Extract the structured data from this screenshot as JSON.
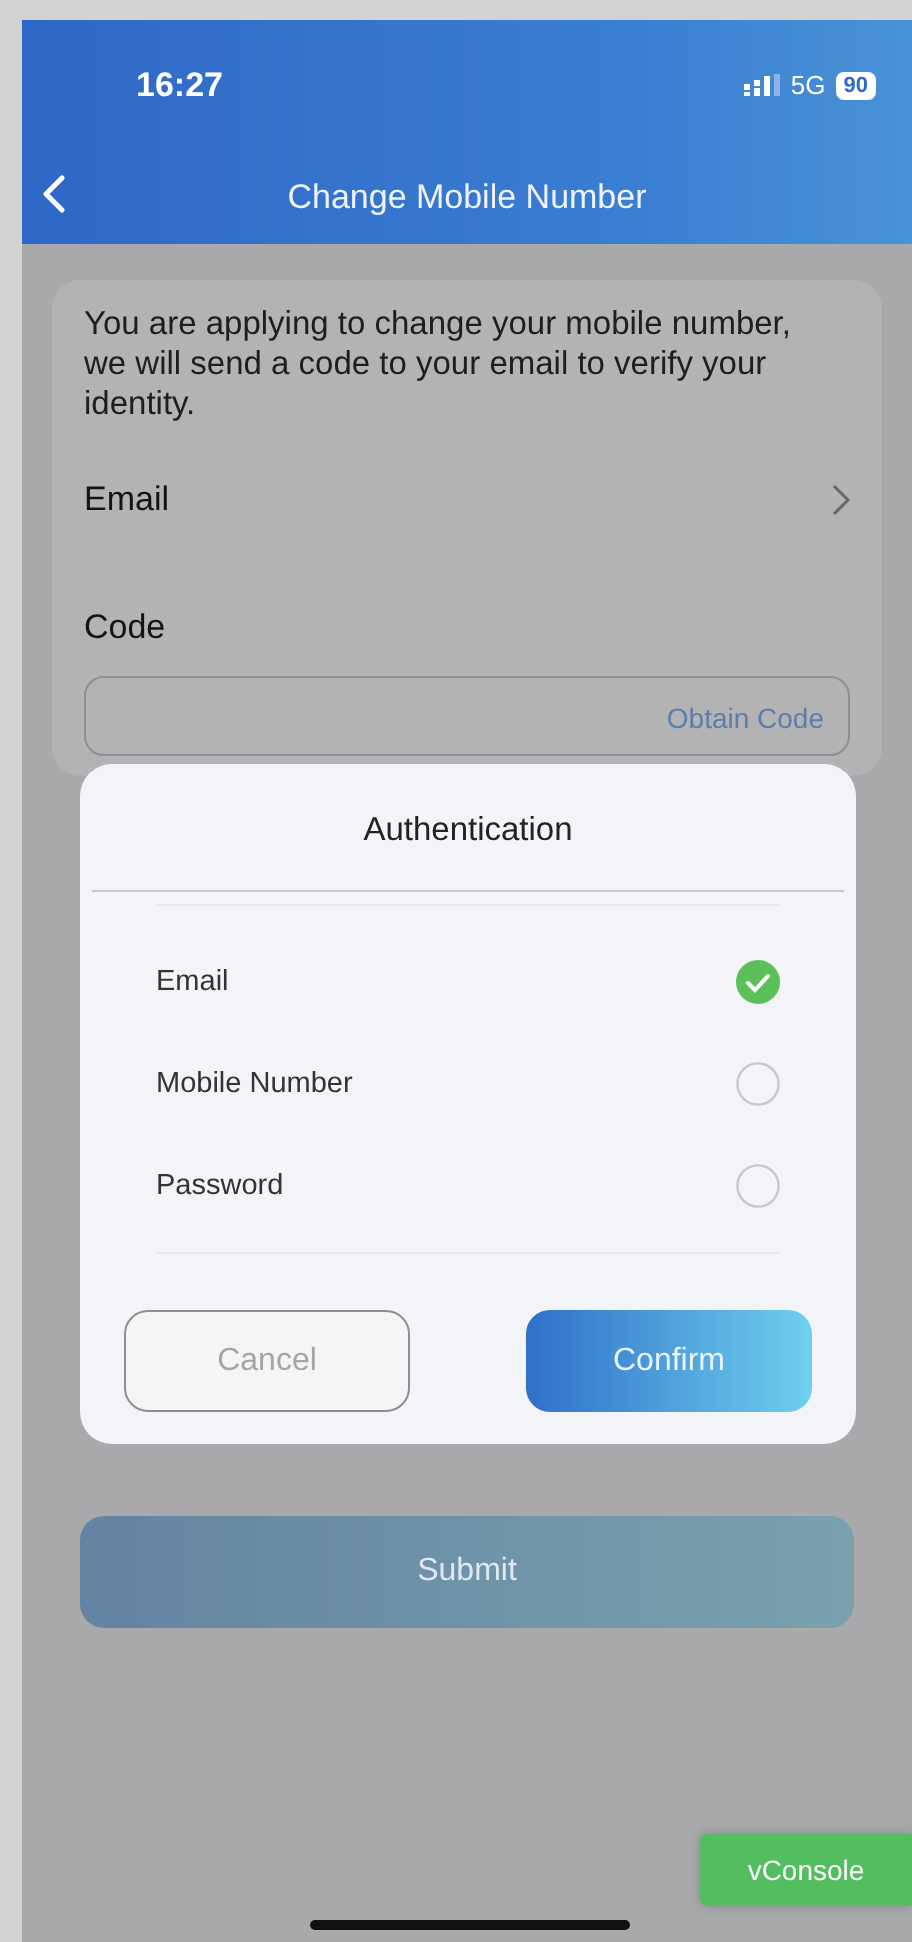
{
  "status_bar": {
    "time": "16:27",
    "network": "5G",
    "battery": "90"
  },
  "header": {
    "title": "Change Mobile Number"
  },
  "form": {
    "notice": "You are applying to change your mobile number, we will send a code to your email to verify your identity.",
    "method_label": "Email",
    "code_label": "Code",
    "obtain_code": "Obtain Code"
  },
  "dialog": {
    "title": "Authentication",
    "options": [
      {
        "label": "Email",
        "selected": true
      },
      {
        "label": "Mobile Number",
        "selected": false
      },
      {
        "label": "Password",
        "selected": false
      }
    ],
    "cancel": "Cancel",
    "confirm": "Confirm"
  },
  "submit": "Submit",
  "vconsole": "vConsole"
}
